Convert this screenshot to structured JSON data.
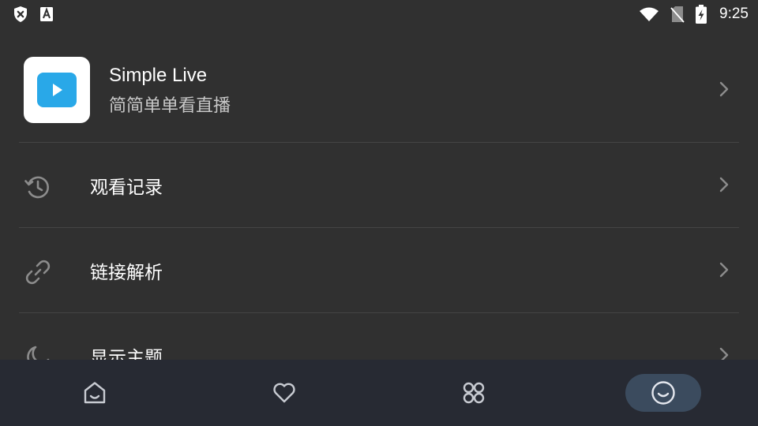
{
  "status_bar": {
    "left_icons": [
      "shield-x-icon",
      "font-a-icon"
    ],
    "right_icons": [
      "wifi-icon",
      "no-sim-icon",
      "battery-charging-icon"
    ],
    "time": "9:25"
  },
  "app_card": {
    "name": "Simple Live",
    "slogan": "简简单单看直播",
    "logo_icon": "play-logo-icon",
    "logo_color": "#29a8e8"
  },
  "menu": [
    {
      "icon": "history-icon",
      "label": "观看记录"
    },
    {
      "icon": "link-icon",
      "label": "链接解析"
    },
    {
      "icon": "moon-icon",
      "label": "显示主题"
    }
  ],
  "bottom_nav": {
    "items": [
      "home-icon",
      "heart-icon",
      "apps-icon",
      "smile-icon"
    ],
    "active_index": 3,
    "active_pill_color": "#3b4b5e",
    "background": "#272a33"
  },
  "colors": {
    "background": "#303030",
    "icon_muted": "#8c8c8c",
    "divider": "#444444"
  }
}
